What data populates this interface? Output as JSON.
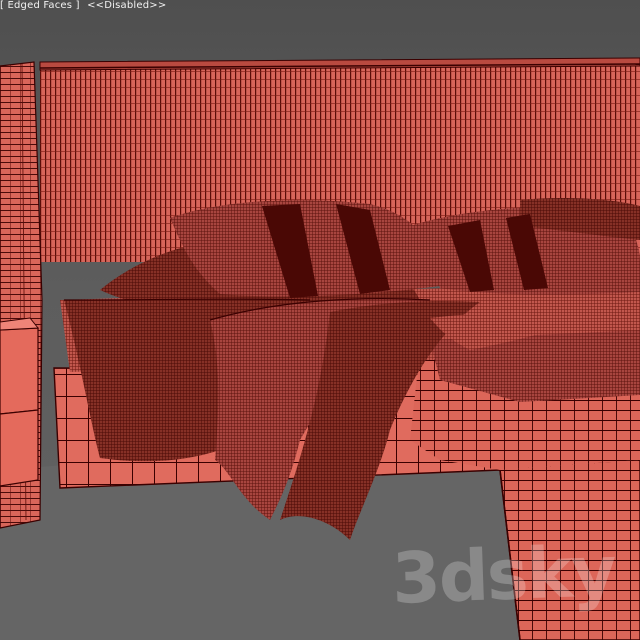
{
  "viewport": {
    "shading_mode": "[ Edged Faces ]",
    "status": "<<Disabled>>",
    "background_color": "#595959",
    "wire_color": "#3a0000",
    "mesh_color": "#e0685c"
  },
  "watermark": {
    "text": "3dsky"
  }
}
